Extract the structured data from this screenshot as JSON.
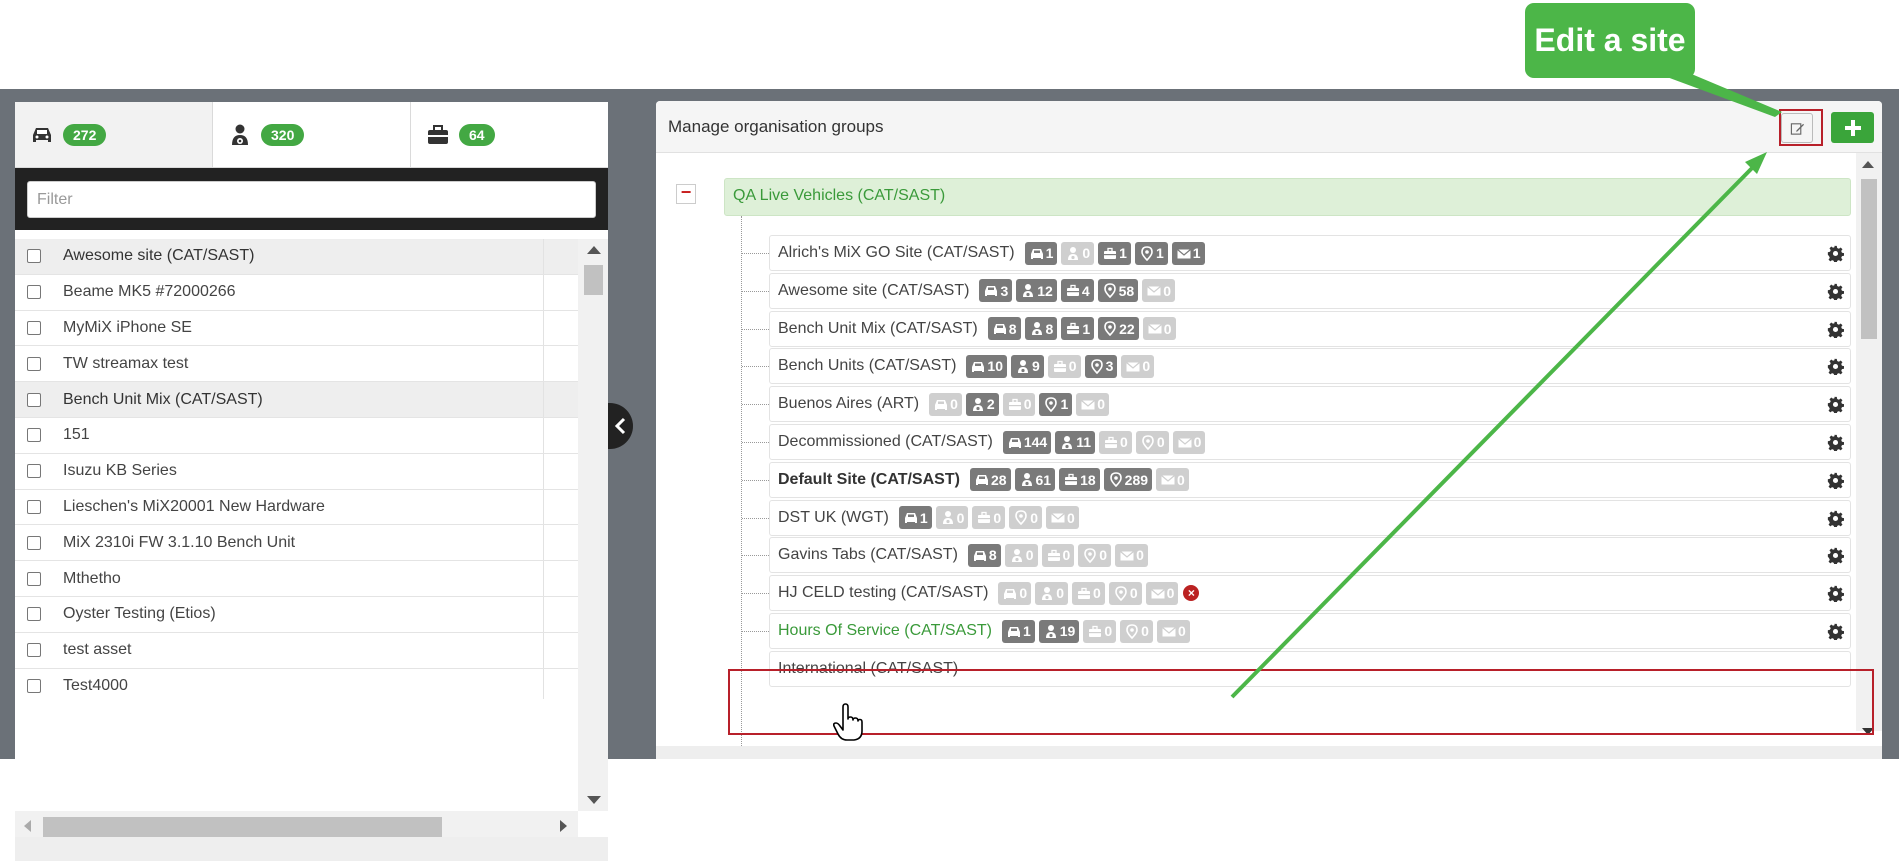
{
  "tabs": [
    {
      "name": "vehicles",
      "icon": "car-icon",
      "count": "272",
      "active": true
    },
    {
      "name": "drivers",
      "icon": "driver-icon",
      "count": "320",
      "active": false
    },
    {
      "name": "assets",
      "icon": "briefcase-icon",
      "count": "64",
      "active": false
    }
  ],
  "filter": {
    "placeholder": "Filter",
    "value": ""
  },
  "list": [
    {
      "label": "Awesome site (CAT/SAST)",
      "group": true
    },
    {
      "label": "Beame MK5 #72000266",
      "group": false
    },
    {
      "label": "MyMiX iPhone SE",
      "group": false
    },
    {
      "label": "TW streamax test",
      "group": false
    },
    {
      "label": "Bench Unit Mix (CAT/SAST)",
      "group": true
    },
    {
      "label": "151",
      "group": false
    },
    {
      "label": "Isuzu KB Series",
      "group": false
    },
    {
      "label": "Lieschen's MiX20001 New Hardware",
      "group": false
    },
    {
      "label": "MiX 2310i FW 3.1.10 Bench Unit",
      "group": false
    },
    {
      "label": "Mthetho",
      "group": false
    },
    {
      "label": "Oyster Testing (Etios)",
      "group": false
    },
    {
      "label": "test asset",
      "group": false
    },
    {
      "label": "Test4000",
      "group": false
    }
  ],
  "right": {
    "title": "Manage organisation groups",
    "root": "QA Live Vehicles (CAT/SAST)",
    "nodes": [
      {
        "label": "Alrich's MiX GO Site (CAT/SAST)",
        "style": "",
        "badges": [
          "1",
          "0",
          "1",
          "1",
          "1"
        ],
        "active": [
          true,
          false,
          true,
          true,
          true
        ],
        "remove": false
      },
      {
        "label": "Awesome site (CAT/SAST)",
        "style": "",
        "badges": [
          "3",
          "12",
          "4",
          "58",
          "0"
        ],
        "active": [
          true,
          true,
          true,
          true,
          false
        ],
        "remove": false
      },
      {
        "label": "Bench Unit Mix (CAT/SAST)",
        "style": "",
        "badges": [
          "8",
          "8",
          "1",
          "22",
          "0"
        ],
        "active": [
          true,
          true,
          true,
          true,
          false
        ],
        "remove": false
      },
      {
        "label": "Bench Units (CAT/SAST)",
        "style": "",
        "badges": [
          "10",
          "9",
          "0",
          "3",
          "0"
        ],
        "active": [
          true,
          true,
          false,
          true,
          false
        ],
        "remove": false
      },
      {
        "label": "Buenos Aires (ART)",
        "style": "",
        "badges": [
          "0",
          "2",
          "0",
          "1",
          "0"
        ],
        "active": [
          false,
          true,
          false,
          true,
          false
        ],
        "remove": false
      },
      {
        "label": "Decommissioned (CAT/SAST)",
        "style": "",
        "badges": [
          "144",
          "11",
          "0",
          "0",
          "0"
        ],
        "active": [
          true,
          true,
          false,
          false,
          false
        ],
        "remove": false
      },
      {
        "label": "Default Site (CAT/SAST)",
        "style": "bold",
        "badges": [
          "28",
          "61",
          "18",
          "289",
          "0"
        ],
        "active": [
          true,
          true,
          true,
          true,
          false
        ],
        "remove": false
      },
      {
        "label": "DST UK (WGT)",
        "style": "",
        "badges": [
          "1",
          "0",
          "0",
          "0",
          "0"
        ],
        "active": [
          true,
          false,
          false,
          false,
          false
        ],
        "remove": false
      },
      {
        "label": "Gavins Tabs (CAT/SAST)",
        "style": "",
        "badges": [
          "8",
          "0",
          "0",
          "0",
          "0"
        ],
        "active": [
          true,
          false,
          false,
          false,
          false
        ],
        "remove": false
      },
      {
        "label": "HJ CELD testing (CAT/SAST)",
        "style": "",
        "badges": [
          "0",
          "0",
          "0",
          "0",
          "0"
        ],
        "active": [
          false,
          false,
          false,
          false,
          false
        ],
        "remove": true
      },
      {
        "label": "Hours Of Service (CAT/SAST)",
        "style": "green",
        "badges": [
          "1",
          "19",
          "0",
          "0",
          "0"
        ],
        "active": [
          true,
          true,
          false,
          false,
          false
        ],
        "remove": false
      },
      {
        "label": "International (CAT/SAST)",
        "style": "",
        "badges": [],
        "active": [],
        "remove": false
      }
    ]
  },
  "callout": {
    "text": "Edit a site",
    "color": "#4cb648"
  },
  "colors": {
    "accent_green": "#3aa53a",
    "highlight_red": "#b8202a",
    "badge_active": "#7a7a7a",
    "badge_inactive": "#cfcfcf"
  }
}
